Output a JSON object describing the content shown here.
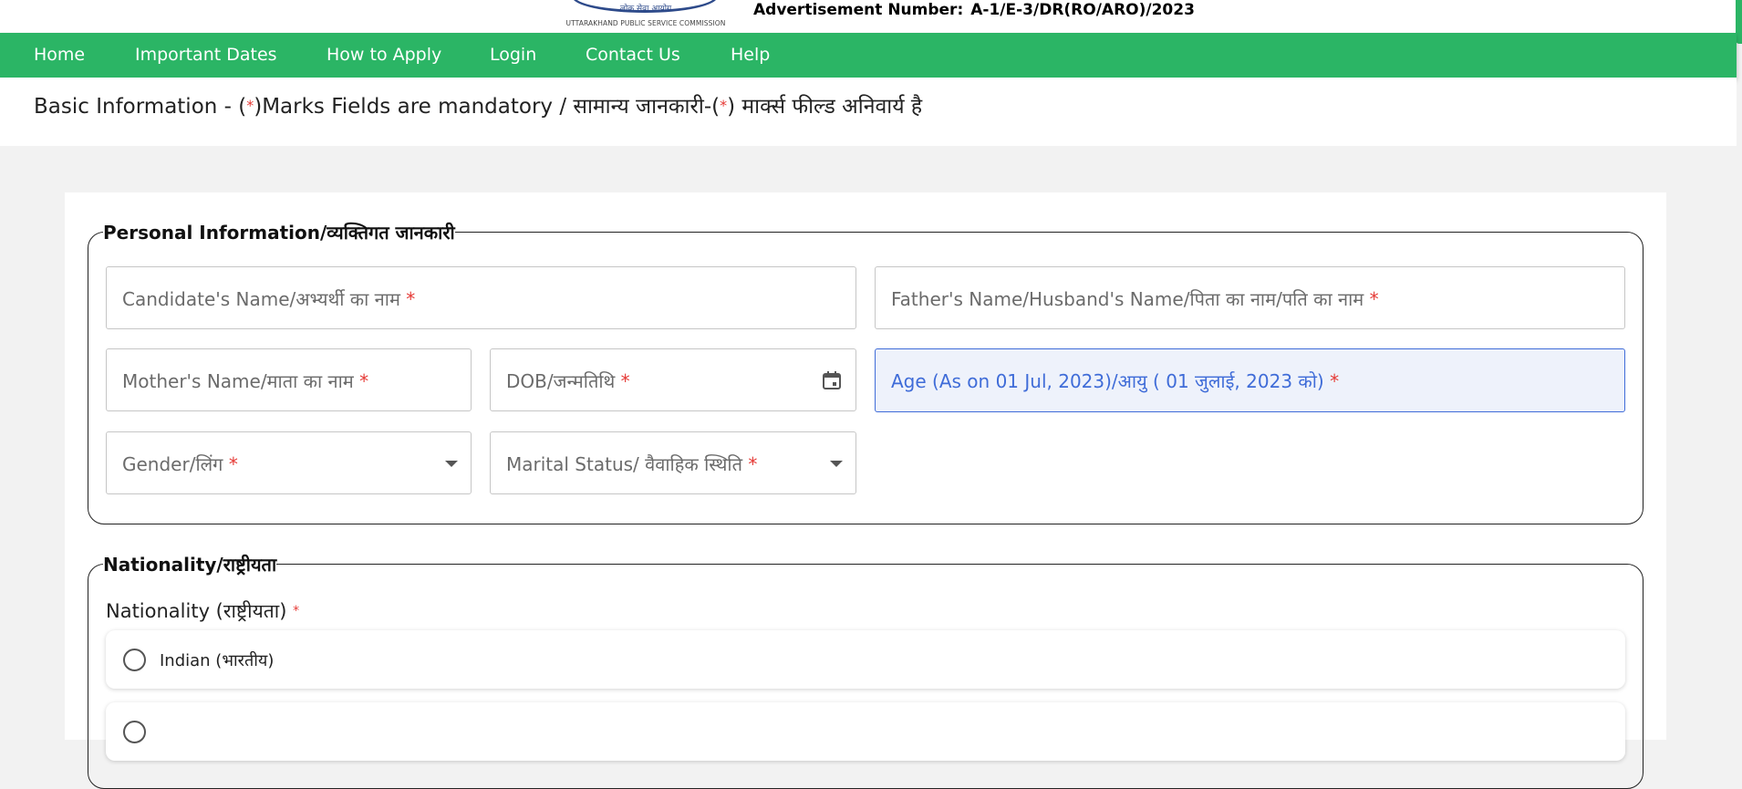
{
  "header": {
    "logo_top_text": "लोक सेवा आयोग",
    "logo_caption": "UTTARAKHAND PUBLIC SERVICE COMMISSION",
    "advertisement_label": "Advertisement Number:",
    "advertisement_value": "A-1/E-3/DR(RO/ARO)/2023"
  },
  "nav": {
    "items": [
      {
        "label": "Home"
      },
      {
        "label": "Important Dates"
      },
      {
        "label": "How to Apply"
      },
      {
        "label": "Login"
      },
      {
        "label": "Contact Us"
      },
      {
        "label": "Help"
      }
    ]
  },
  "info_bar": {
    "prefix": "Basic Information - (",
    "middle": ")Marks Fields are mandatory / सामान्य जानकारी-(",
    "suffix": ") मार्क्स फील्ड अनिवार्य है",
    "star": "*"
  },
  "personal": {
    "legend": "Personal Information/व्यक्तिगत जानकारी",
    "required_mark": "*",
    "fields": {
      "candidate_name": "Candidate's Name/अभ्यर्थी का नाम",
      "father_name": "Father's Name/Husband's Name/पिता का नाम/पति का नाम",
      "mother_name": "Mother's Name/माता का नाम",
      "dob": "DOB/जन्मतिथि",
      "age": "Age (As on 01 Jul, 2023)/आयु ( 01 जुलाई, 2023 को)",
      "gender": "Gender/लिंग",
      "marital_status": "Marital Status/ वैवाहिक स्थिति"
    }
  },
  "nationality": {
    "legend": "Nationality/राष्ट्रीयता",
    "label": "Nationality (राष्ट्रीयता)",
    "required_mark": "*",
    "options": [
      {
        "label": "Indian (भारतीय)"
      },
      {
        "label": ""
      }
    ]
  },
  "colors": {
    "nav_green": "#2bb565",
    "focus_blue": "#3f6cd8",
    "required_red": "#e53935"
  }
}
